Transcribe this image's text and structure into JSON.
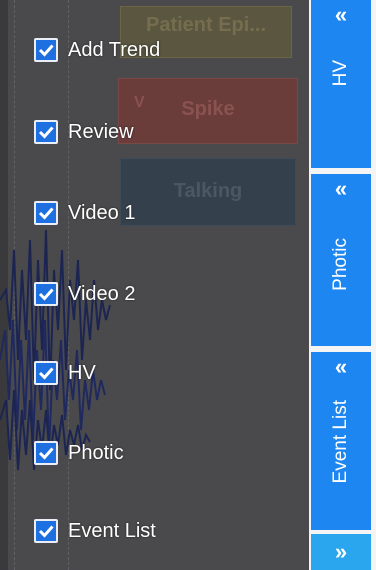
{
  "background": {
    "events": [
      {
        "label": "Patient Epi..."
      },
      {
        "label": "Spike",
        "marker": "V"
      },
      {
        "label": "Talking"
      }
    ]
  },
  "menu": {
    "items": [
      {
        "label": "Add Trend",
        "checked": true
      },
      {
        "label": "Review",
        "checked": true
      },
      {
        "label": "Video 1",
        "checked": true
      },
      {
        "label": "Video 2",
        "checked": true
      },
      {
        "label": "HV",
        "checked": true
      },
      {
        "label": "Photic",
        "checked": true
      },
      {
        "label": "Event List",
        "checked": true
      }
    ]
  },
  "side_panel": {
    "tabs": [
      {
        "label": "HV",
        "icon": "double-chevron-left-icon",
        "glyph": "«"
      },
      {
        "label": "Photic",
        "icon": "double-chevron-left-icon",
        "glyph": "«"
      },
      {
        "label": "Event List",
        "icon": "double-chevron-left-icon",
        "glyph": "«"
      }
    ],
    "more": {
      "icon": "double-chevron-right-icon",
      "glyph": "»"
    }
  },
  "colors": {
    "accent": "#1e86f0",
    "checkbox": "#1e6fe0",
    "overlay": "#4a4a4c"
  }
}
